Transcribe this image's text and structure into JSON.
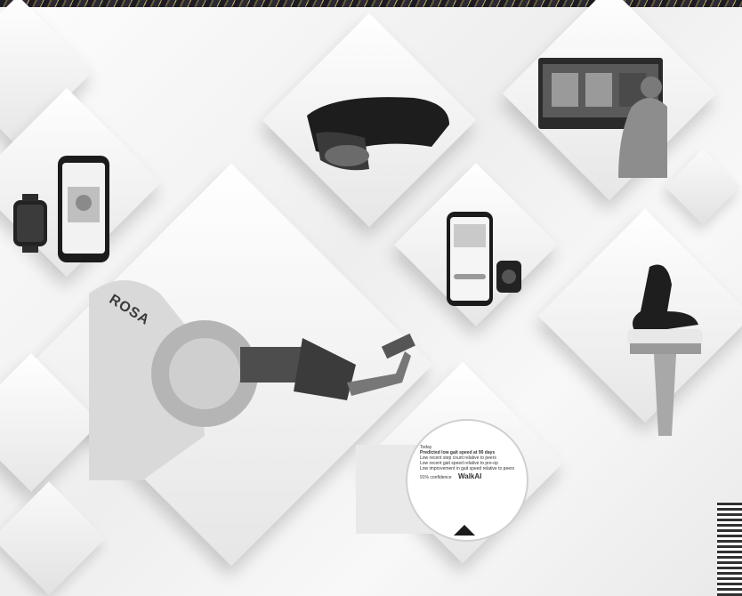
{
  "image": {
    "description_items": [
      "smartwatch-and-phone-app",
      "mixed-reality-headset",
      "surgical-display-screen-with-surgeon",
      "phone-and-watch-rehab-app",
      "rosa-surgical-robot-arm",
      "knee-implant",
      "walk-ai-app-magnifier"
    ],
    "robot_label": "ROSA",
    "app_popup": {
      "title": "Today",
      "headline": "Predicted low gait speed at 90 days",
      "bullets": [
        "Low recent step count relative to peers",
        "Low recent gait speed relative to pre-op",
        "Low improvement in gait speed relative to peers"
      ],
      "brand": "WalkAI",
      "confidence_label": "91% confidence"
    }
  }
}
